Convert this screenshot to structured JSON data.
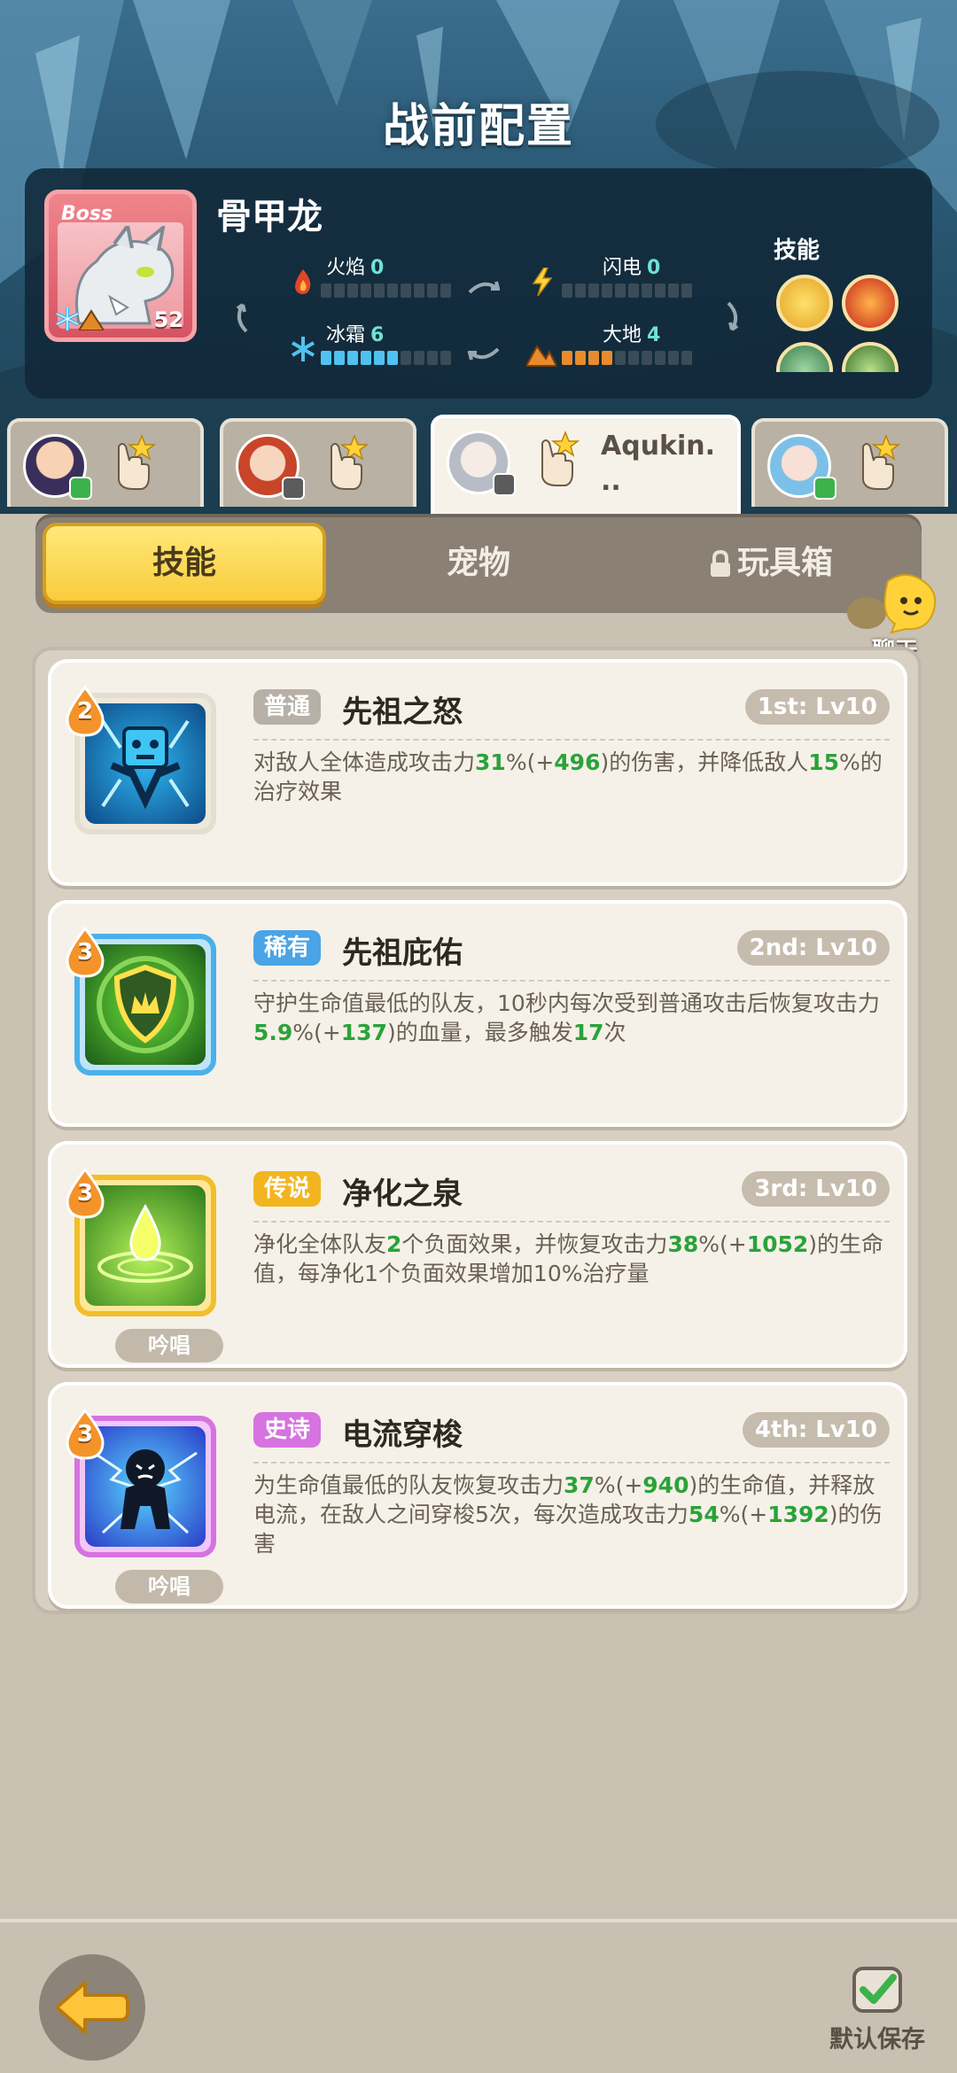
{
  "page": {
    "title": "战前配置"
  },
  "boss": {
    "tag": "Boss",
    "name": "骨甲龙",
    "level": "52",
    "elements": [
      {
        "label": "火焰",
        "value": "0",
        "filled": 0,
        "color": "orange"
      },
      {
        "label": "闪电",
        "value": "0",
        "filled": 0,
        "color": "blue"
      },
      {
        "label": "冰霜",
        "value": "6",
        "filled": 6,
        "color": "blue"
      },
      {
        "label": "大地",
        "value": "4",
        "filled": 4,
        "color": "orange"
      }
    ],
    "skills_title": "技能"
  },
  "heroes": [
    {
      "name": "",
      "badge_color": "#3cb34a"
    },
    {
      "name": "",
      "badge_color": "#5b5b5b"
    },
    {
      "name": "Aqukin.\n..",
      "badge_color": "#5b5b5b",
      "active": true
    },
    {
      "name": "",
      "badge_color": "#3cb34a"
    }
  ],
  "category_tabs": {
    "skills": "技能",
    "pets": "宠物",
    "toybox": "玩具箱"
  },
  "chat": {
    "label": "聊天"
  },
  "skills": [
    {
      "cost": "2",
      "rarity": "普通",
      "rarity_color": "#b7b0a6",
      "name": "先祖之怒",
      "level": "1st: Lv10",
      "desc_parts": [
        "对敌人全体造成攻击力",
        "31",
        "%(+",
        "496",
        ")的伤害，并降低敌人",
        "15",
        "%的治疗效果"
      ],
      "chant": ""
    },
    {
      "cost": "3",
      "rarity": "稀有",
      "rarity_color": "#4aa4e6",
      "name": "先祖庇佑",
      "level": "2nd: Lv10",
      "desc_parts": [
        "守护生命值最低的队友，10秒内每次受到普通攻击后恢复攻击力",
        "5.9",
        "%(+",
        "137",
        ")的血量，最多触发",
        "17",
        "次"
      ],
      "chant": ""
    },
    {
      "cost": "3",
      "rarity": "传说",
      "rarity_color": "#f2b51e",
      "name": "净化之泉",
      "level": "3rd: Lv10",
      "desc_parts": [
        "净化全体队友",
        "2",
        "个负面效果，并恢复攻击力",
        "38",
        "%(+",
        "1052",
        ")的生命值，每净化1个负面效果增加10%治疗量"
      ],
      "chant": "吟唱"
    },
    {
      "cost": "3",
      "rarity": "史诗",
      "rarity_color": "#d673e0",
      "name": "电流穿梭",
      "level": "4th: Lv10",
      "desc_parts": [
        "为生命值最低的队友恢复攻击力",
        "37",
        "%(+",
        "940",
        ")的生命值，并释放电流，在敌人之间穿梭5次，每次造成攻击力",
        "54",
        "%(+",
        "1392",
        ")的伤害"
      ],
      "chant": "吟唱"
    }
  ],
  "bottom": {
    "save_label": "默认保存",
    "save_checked": true
  }
}
